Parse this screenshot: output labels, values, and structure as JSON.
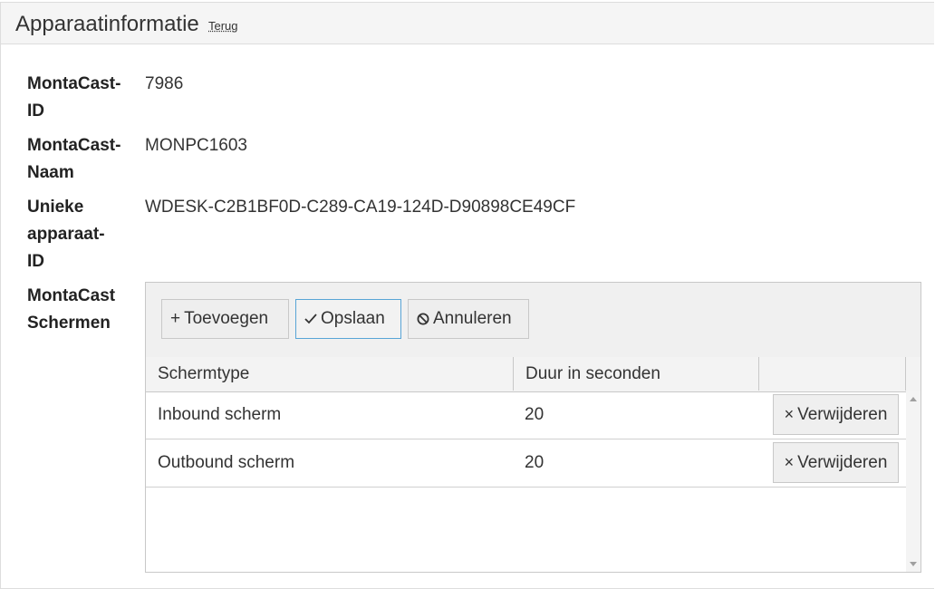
{
  "header": {
    "title": "Apparaatinformatie",
    "back_link": "Terug"
  },
  "fields": [
    {
      "label_lines": [
        "MontaCast-",
        "ID"
      ],
      "value": "7986"
    },
    {
      "label_lines": [
        "MontaCast-",
        "Naam"
      ],
      "value": "MONPC1603"
    },
    {
      "label_lines": [
        "Unieke",
        "apparaat-",
        "ID"
      ],
      "value": "WDESK-C2B1BF0D-C289-CA19-124D-D90898CE49CF"
    },
    {
      "label_lines": [
        "MontaCast",
        "Schermen"
      ]
    }
  ],
  "toolbar": {
    "add_label": "Toevoegen",
    "save_label": "Opslaan",
    "cancel_label": "Annuleren"
  },
  "table": {
    "columns": [
      "Schermtype",
      "Duur in seconden",
      ""
    ],
    "rows": [
      {
        "type": "Inbound scherm",
        "duration": "20",
        "action": "Verwijderen"
      },
      {
        "type": "Outbound scherm",
        "duration": "20",
        "action": "Verwijderen"
      }
    ]
  },
  "colors": {
    "primary_border": "#58a5d6",
    "heading_bg": "#f5f5f5"
  }
}
